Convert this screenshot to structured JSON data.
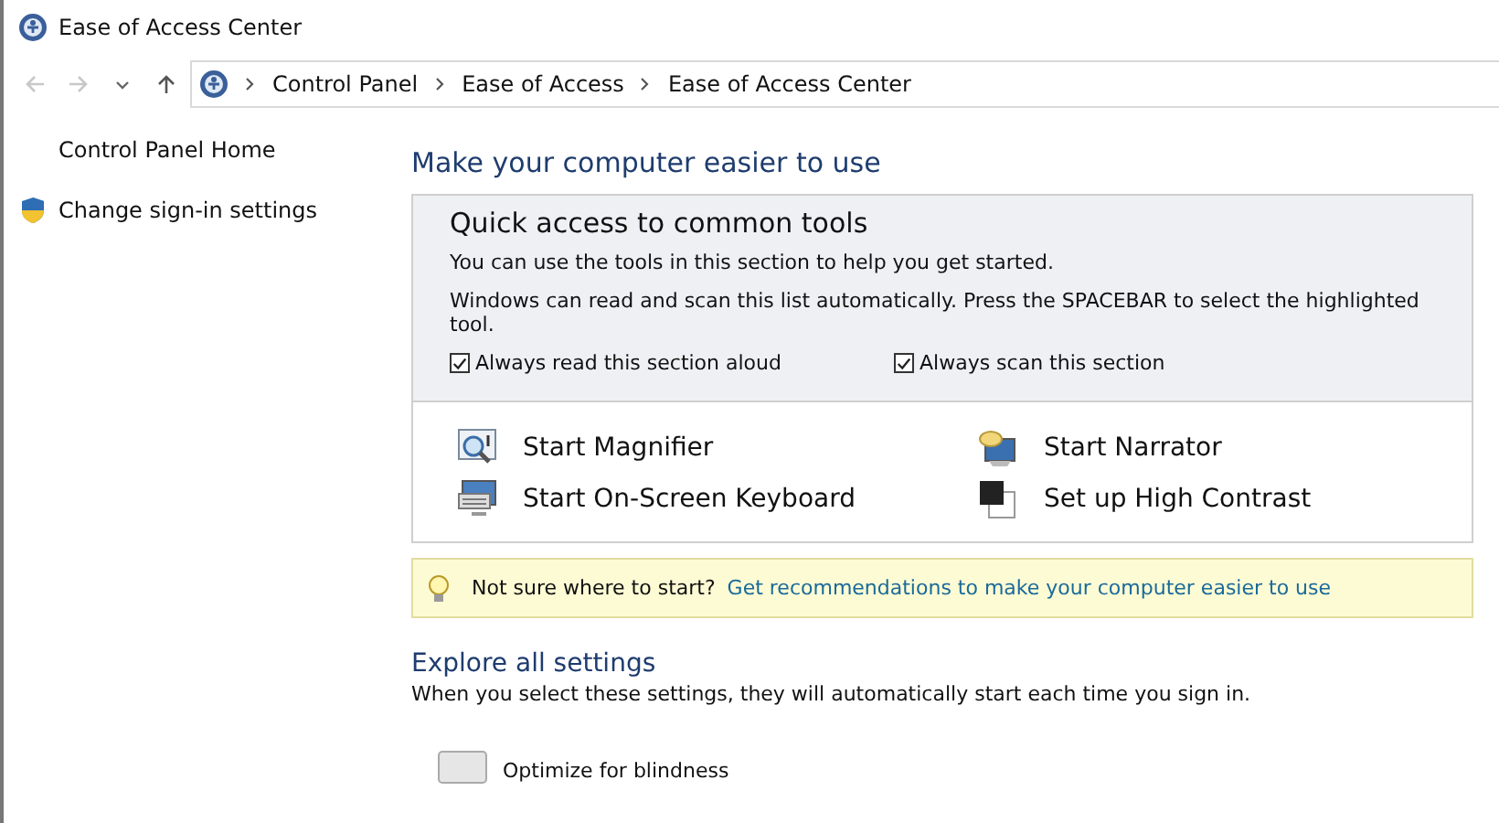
{
  "window": {
    "title": "Ease of Access Center"
  },
  "breadcrumb": [
    {
      "label": "Control Panel"
    },
    {
      "label": "Ease of Access"
    },
    {
      "label": "Ease of Access Center"
    }
  ],
  "sidebar": {
    "items": [
      {
        "label": "Control Panel Home",
        "kind": "link"
      },
      {
        "label": "Change sign-in settings",
        "kind": "shield"
      }
    ]
  },
  "main": {
    "heading": "Make your computer easier to use",
    "quick_access": {
      "title": "Quick access to common tools",
      "lines": [
        "You can use the tools in this section to help you get started.",
        "Windows can read and scan this list automatically.  Press the SPACEBAR to select the highlighted tool."
      ],
      "checkboxes": [
        {
          "label": "Always read this section aloud",
          "checked": true
        },
        {
          "label": "Always scan this section",
          "checked": true
        }
      ],
      "tools": [
        {
          "label": "Start Magnifier",
          "kind": "magnifier"
        },
        {
          "label": "Start Narrator",
          "kind": "narrator"
        },
        {
          "label": "Start On-Screen Keyboard",
          "kind": "keyboard"
        },
        {
          "label": "Set up High Contrast",
          "kind": "contrast"
        }
      ]
    },
    "tip": {
      "text": "Not sure where to start?",
      "link": "Get recommendations to make your computer easier to use"
    },
    "explore": {
      "title": "Explore all settings",
      "text": "When you select these settings, they will automatically start each time you sign in.",
      "items": [
        {
          "label": "Optimize for blindness"
        }
      ]
    }
  }
}
